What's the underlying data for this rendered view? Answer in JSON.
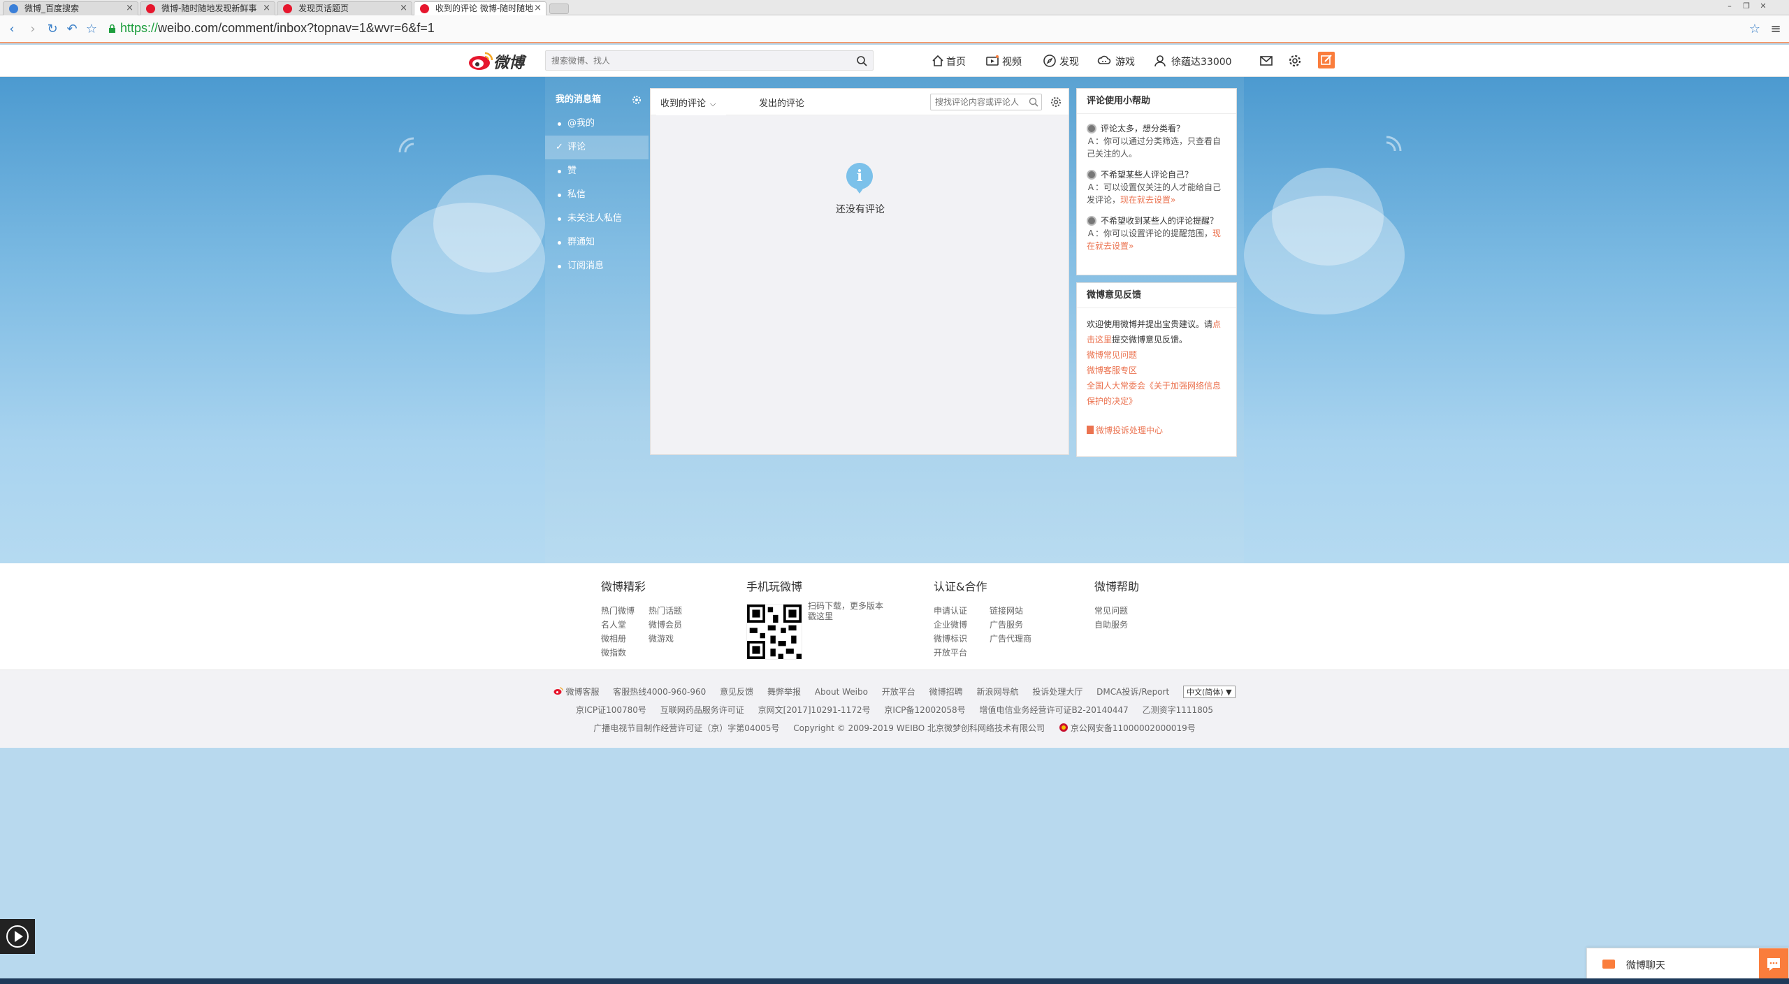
{
  "browser": {
    "tabs": [
      {
        "title": "微博_百度搜索",
        "close": "×",
        "favicon_color": "#3a7fd8"
      },
      {
        "title": "微博-随时随地发现新鲜事",
        "close": "×",
        "favicon_color": "#e6162d"
      },
      {
        "title": "发现页话题页",
        "close": "×",
        "favicon_color": "#e6162d"
      },
      {
        "title": "收到的评论 微博-随时随地",
        "close": "×",
        "favicon_color": "#e6162d"
      }
    ],
    "url_scheme": "https://",
    "url_rest": "weibo.com/comment/inbox?topnav=1&wvr=6&f=1",
    "nav_back": "‹",
    "nav_forward": "›",
    "nav_reload": "↻",
    "nav_undo": "↶",
    "nav_star": "☆",
    "right_star": "☆",
    "menu": "≡",
    "win_min": "–",
    "win_max": "❐",
    "win_close": "✕"
  },
  "weibo_nav": {
    "logo_text": "微博",
    "search_placeholder": "搜索微博、找人",
    "items": {
      "home": "首页",
      "video": "视频",
      "discover": "发现",
      "game": "游戏",
      "user": "徐蕴达33000"
    }
  },
  "left_menu": {
    "title": "我的消息箱",
    "items": [
      "@我的",
      "评论",
      "赞",
      "私信",
      "未关注人私信",
      "群通知",
      "订阅消息"
    ],
    "active_index": 1
  },
  "center": {
    "tab_received": "收到的评论",
    "tab_received_chevron": "⌵",
    "tab_sent": "发出的评论",
    "search_placeholder": "搜找评论内容或评论人",
    "empty_icon": "i",
    "empty_text": "还没有评论"
  },
  "help_panel": {
    "title": "评论使用小帮助",
    "qa": [
      {
        "q": "评论太多，想分类看？",
        "a": "Ａ：你可以通过分类筛选，只查看自己关注的人。",
        "link": ""
      },
      {
        "q": "不希望某些人评论自己？",
        "a": "Ａ：可以设置仅关注的人才能给自己发评论，",
        "link": "现在就去设置»"
      },
      {
        "q": "不希望收到某些人的评论提醒？",
        "a": "Ａ：你可以设置评论的提醒范围，",
        "link": "现在就去设置»"
      }
    ]
  },
  "feedback_panel": {
    "title": "微博意见反馈",
    "intro_a": "欢迎使用微博并提出宝贵建议。请",
    "intro_link": "点击这里",
    "intro_b": "提交微博意见反馈。",
    "links": [
      "微博常见问题",
      "微博客服专区",
      "全国人大常委会《关于加强网络信息保护的决定》"
    ],
    "complaint": "微博投诉处理中心"
  },
  "footer": {
    "col1": {
      "title": "微博精彩",
      "links": [
        "热门微博",
        "热门话题",
        "名人堂",
        "微博会员",
        "微相册",
        "微游戏",
        "微指数"
      ]
    },
    "col2": {
      "title": "手机玩微博",
      "desc": "扫码下载，更多版本戳这里"
    },
    "col3": {
      "title": "认证&合作",
      "links": [
        "申请认证",
        "链接网站",
        "企业微博",
        "广告服务",
        "微博标识",
        "广告代理商",
        "开放平台"
      ]
    },
    "col4": {
      "title": "微博帮助",
      "links": [
        "常见问题",
        "自助服务"
      ]
    },
    "line1": [
      "微博客服",
      "客服热线4000-960-960",
      "意见反馈",
      "舞弊举报",
      "About Weibo",
      "开放平台",
      "微博招聘",
      "新浪网导航",
      "投诉处理大厅",
      "DMCA投诉/Report"
    ],
    "lang_select": "中文(简体) ▼",
    "line2": [
      "京ICP证100780号",
      "互联网药品服务许可证",
      "京网文[2017]10291-1172号",
      "京ICP备12002058号",
      "增值电信业务经营许可证B2-20140447",
      "乙测资字1111805"
    ],
    "line3": [
      "广播电视节目制作经营许可证（京）字第04005号",
      "Copyright © 2009-2019 WEIBO 北京微梦创科网络技术有限公司",
      "京公网安备11000002000019号"
    ]
  },
  "chat": {
    "label": "微博聊天"
  }
}
